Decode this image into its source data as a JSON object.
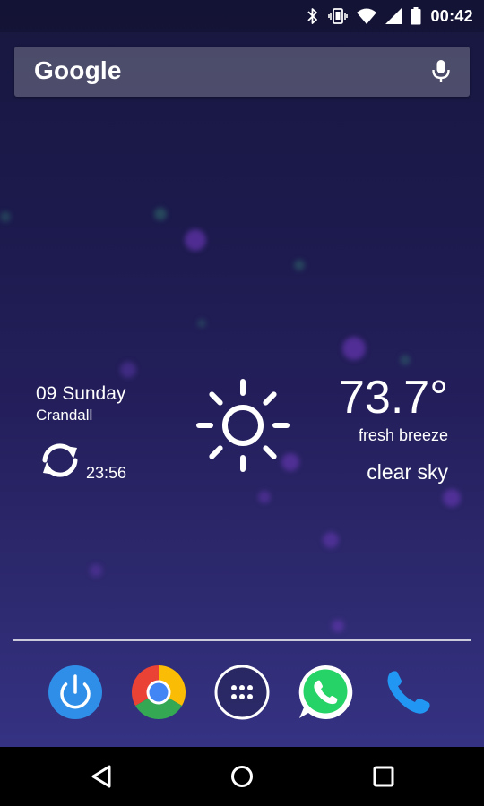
{
  "status_bar": {
    "time": "00:42",
    "icons": [
      "bluetooth-icon",
      "vibrate-icon",
      "wifi-icon",
      "signal-icon",
      "battery-icon"
    ]
  },
  "search": {
    "logo_text": "Google",
    "mic_icon": "mic-icon"
  },
  "weather_widget": {
    "date": "09 Sunday",
    "city": "Crandall",
    "refresh_icon": "refresh-icon",
    "updated_time": "23:56",
    "condition_icon": "sun-icon",
    "temperature": "73.7°",
    "wind": "fresh breeze",
    "condition": "clear sky"
  },
  "dock": {
    "apps": [
      {
        "name": "power-app",
        "icon": "power-icon",
        "color": "#2f8ee8"
      },
      {
        "name": "chrome-app",
        "icon": "chrome-icon",
        "color": "#db4437"
      },
      {
        "name": "all-apps",
        "icon": "app-drawer-icon",
        "color": "#ffffff"
      },
      {
        "name": "whatsapp-app",
        "icon": "whatsapp-icon",
        "color": "#25d366"
      },
      {
        "name": "phone-app",
        "icon": "phone-icon",
        "color": "#2196f3"
      }
    ]
  },
  "nav_bar": {
    "buttons": [
      "back-icon",
      "home-icon",
      "recents-icon"
    ]
  }
}
